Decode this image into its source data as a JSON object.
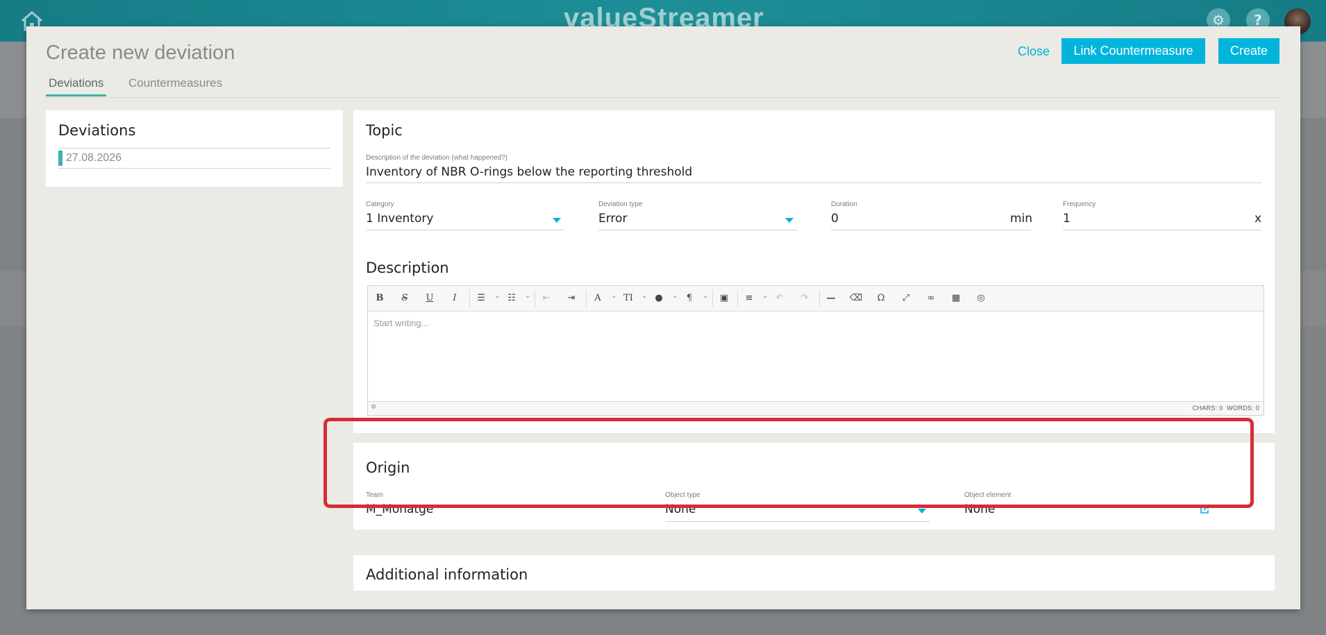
{
  "brand": "valueStreamer",
  "dialog": {
    "title": "Create new deviation",
    "close_label": "Close",
    "link_label": "Link Countermeasure",
    "create_label": "Create",
    "tabs": [
      "Deviations",
      "Countermeasures"
    ]
  },
  "sidebar": {
    "title": "Deviations",
    "items": [
      "27.08.2026"
    ]
  },
  "topic": {
    "title": "Topic",
    "description_label": "Description of the deviation (what happened?)",
    "description_value": "Inventory of NBR O-rings below the reporting threshold",
    "category_label": "Category",
    "category_value": "1 Inventory",
    "type_label": "Deviation type",
    "type_value": "Error",
    "duration_label": "Duration",
    "duration_value": "0",
    "duration_unit": "min",
    "frequency_label": "Frequency",
    "frequency_value": "1",
    "frequency_unit": "x"
  },
  "description": {
    "title": "Description",
    "placeholder": "Start writing...",
    "chars": "CHARS: 0",
    "words": "WORDS: 0",
    "toolbar_icons": [
      "bold-icon",
      "strikethrough-icon",
      "underline-icon",
      "italic-icon",
      "bulleted-list-icon",
      "numbered-list-icon",
      "outdent-icon",
      "indent-icon",
      "font-family-icon",
      "font-size-icon",
      "font-color-icon",
      "paragraph-icon",
      "image-icon",
      "align-icon",
      "undo-icon",
      "redo-icon",
      "horizontal-line-icon",
      "remove-format-icon",
      "special-char-icon",
      "fullscreen-icon",
      "link-icon",
      "table-icon",
      "source-icon"
    ]
  },
  "origin": {
    "title": "Origin",
    "team_label": "Team",
    "team_value": "M_Monatge",
    "object_type_label": "Object type",
    "object_type_value": "None",
    "object_element_label": "Object element",
    "object_element_value": "None"
  },
  "additional": {
    "title": "Additional information"
  },
  "colors": {
    "accent": "#00b4dc",
    "tab_indicator": "#3fb1a6",
    "highlight": "#d62d35",
    "topbar": "#1d8e97"
  }
}
